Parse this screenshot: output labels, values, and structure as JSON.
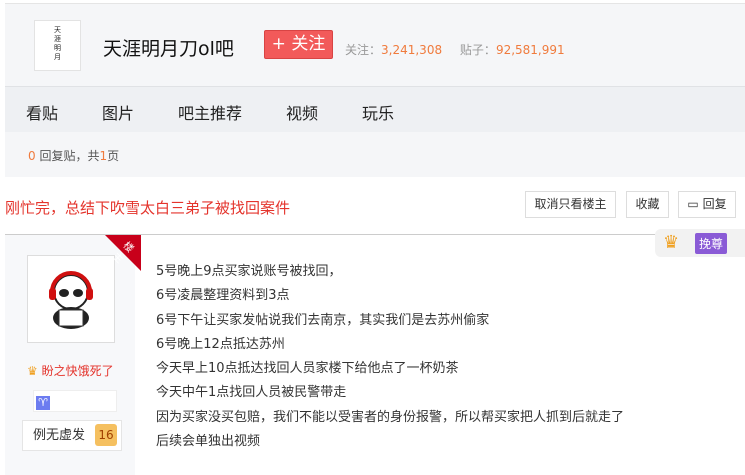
{
  "forum": {
    "logo_text": "天涯明月刀",
    "name": "天涯明月刀ol吧",
    "follow_label": "+ 关注",
    "followers_label": "关注：",
    "followers": "3,241,308",
    "posts_label": "贴子：",
    "posts": "92,581,991"
  },
  "nav": [
    "看贴",
    "图片",
    "吧主推荐",
    "视频",
    "玩乐"
  ],
  "reply_count": {
    "count": "0",
    "mid": " 回复贴，共",
    "pages": "1",
    "end": "页"
  },
  "thread": {
    "title": "刚忙完，总结下吹雪太白三弟子被找回案件",
    "buttons": {
      "only_op": "取消只看楼主",
      "favorite": "收藏",
      "reply": "回复"
    }
  },
  "post": {
    "op_badge": "楼主",
    "username": "盼之快饿死了",
    "level_name": "例无虚发",
    "level": "16",
    "reward_label": "挽尊",
    "lines": [
      "5号晚上9点买家说账号被找回，",
      "6号凌晨整理资料到3点",
      "6号下午让买家发帖说我们去南京，其实我们是去苏州偷家",
      "6号晚上12点抵达苏州",
      "今天早上10点抵达找回人员家楼下给他点了一杯奶茶",
      "今天中午1点找回人员被民警带走",
      "因为买家没买包赔，我们不能以受害者的身份报警，所以帮买家把人抓到后就走了",
      "后续会单独出视频"
    ]
  }
}
